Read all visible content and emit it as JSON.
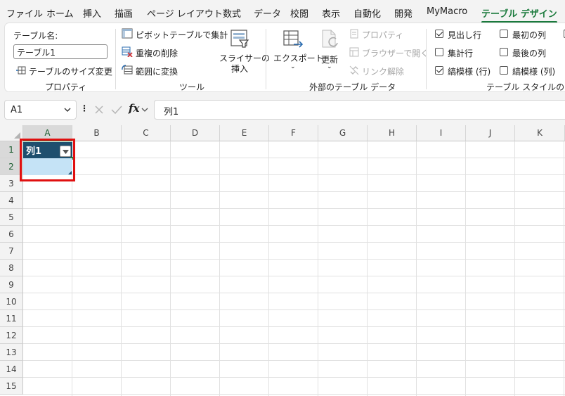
{
  "menu": {
    "tabs": [
      {
        "label": "ファイル"
      },
      {
        "label": "ホーム"
      },
      {
        "label": "挿入"
      },
      {
        "label": "描画"
      },
      {
        "label": "ページ レイアウト"
      },
      {
        "label": "数式"
      },
      {
        "label": "データ"
      },
      {
        "label": "校閲"
      },
      {
        "label": "表示"
      },
      {
        "label": "自動化"
      },
      {
        "label": "開発"
      },
      {
        "label": "MyMacro"
      },
      {
        "label": "テーブル デザイン"
      }
    ],
    "active_tab": "テーブル デザイン"
  },
  "ribbon": {
    "properties": {
      "table_name_label": "テーブル名:",
      "table_name_value": "テーブル1",
      "resize_label": "テーブルのサイズ変更",
      "group_label": "プロパティ"
    },
    "tools": {
      "pivot_label": "ピボットテーブルで集計",
      "remove_dup_label": "重複の削除",
      "convert_label": "範囲に変換",
      "slicer_line1": "スライサーの",
      "slicer_line2": "挿入",
      "group_label": "ツール"
    },
    "external": {
      "export_label": "エクスポート",
      "refresh_label": "更新",
      "properties_label": "プロパティ",
      "browser_label": "ブラウザーで開く",
      "unlink_label": "リンク解除",
      "group_label": "外部のテーブル データ"
    },
    "style_options": {
      "header_row": {
        "label": "見出し行",
        "checked": true
      },
      "total_row": {
        "label": "集計行",
        "checked": false
      },
      "banded_rows": {
        "label": "縞模様 (行)",
        "checked": true
      },
      "first_column": {
        "label": "最初の列",
        "checked": false
      },
      "last_column": {
        "label": "最後の列",
        "checked": false
      },
      "banded_columns": {
        "label": "縞模様 (列)",
        "checked": false
      },
      "group_label": "テーブル スタイルのオプシ"
    }
  },
  "formula_bar": {
    "name_box": "A1",
    "fx": "fx",
    "content": "列1"
  },
  "grid": {
    "columns": [
      "A",
      "B",
      "C",
      "D",
      "E",
      "F",
      "G",
      "H",
      "I",
      "J",
      "K"
    ],
    "rows": [
      "1",
      "2",
      "3",
      "4",
      "5",
      "6",
      "7",
      "8",
      "9",
      "10",
      "11",
      "12",
      "13",
      "14",
      "15"
    ],
    "selected_column": "A",
    "selected_rows": [
      "1",
      "2"
    ],
    "table_header": "列1"
  },
  "colors": {
    "accent": "#1a7a3c",
    "table_header_bg": "#1e4f6e",
    "table_row_bg": "#c5e3f6",
    "highlight_box": "#e01010"
  }
}
